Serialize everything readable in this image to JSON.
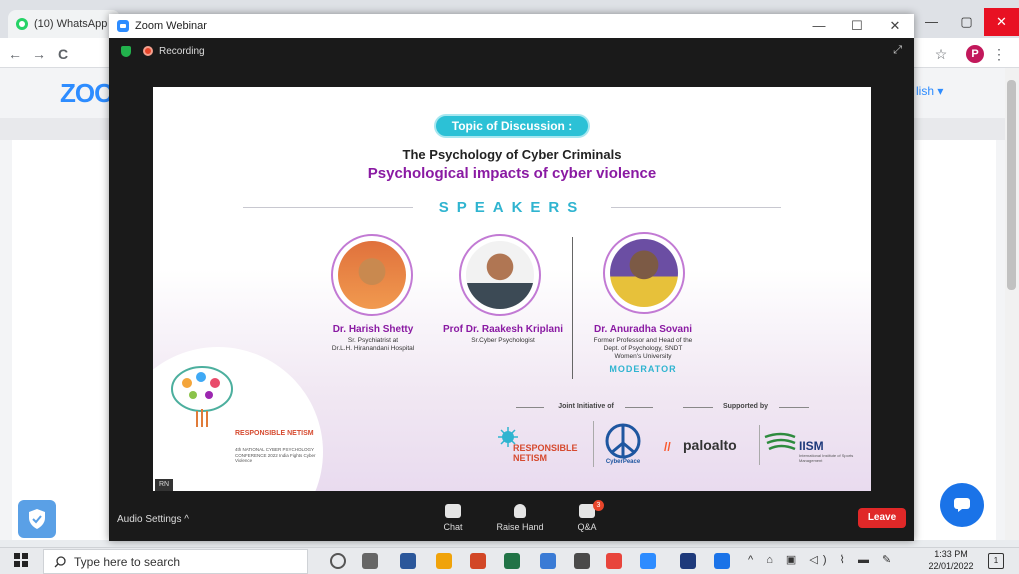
{
  "browser": {
    "tab_label": "(10) WhatsApp",
    "profile_initial": "P",
    "back_label": "←",
    "forward_label": "→",
    "reload_label": "C",
    "star_label": "☆",
    "menu_label": "⋮",
    "window_controls": [
      "—",
      "▢",
      "✕"
    ]
  },
  "page": {
    "logo_text": "ZOO",
    "language_label": "lish ▾"
  },
  "zoom": {
    "window_title": "Zoom Webinar",
    "window_controls": [
      "—",
      "☐",
      "✕"
    ],
    "recording_label": "Recording",
    "expand_label": "⤢"
  },
  "slide": {
    "topic_pill": "Topic of Discussion :",
    "title_line1": "The Psychology of Cyber Criminals",
    "title_line2": "Psychological impacts of cyber violence",
    "speakers_heading": "SPEAKERS",
    "speakers": [
      {
        "name": "Dr. Harish Shetty",
        "role": "Sr. Psychiatrist at\nDr.L.H. Hiranandani Hospital"
      },
      {
        "name": "Prof Dr. Raakesh Kriplani",
        "role": "Sr.Cyber Psychologist"
      },
      {
        "name": "Dr. Anuradha Sovani",
        "role": "Former Professor and Head of the\nDept. of Psychology, SNDT\nWomen's University"
      }
    ],
    "moderator_label": "MODERATOR",
    "joint_label": "Joint Initiative of",
    "supported_label": "Supported by",
    "conference_title": "RESPONSIBLE NETISM",
    "conference_sub": "4th NATIONAL CYBER PSYCHOLOGY CONFERENCE 2022 India Fights Cyber Violence",
    "logo_rn": "RESPONSIBLE NETISM",
    "logo_cpf": "CyberPeace",
    "logo_paloalto": "paloalto",
    "logo_paloalto_mark": "//",
    "logo_iism": "IISM",
    "logo_iism_sub": "International Institute of Sports Management",
    "rn_badge": "RN"
  },
  "toolbar": {
    "audio_settings": "Audio Settings  ^",
    "chat": "Chat",
    "raise_hand": "Raise Hand",
    "qa": "Q&A",
    "qa_badge": "3",
    "leave": "Leave"
  },
  "taskbar": {
    "search_placeholder": "Type here to search",
    "time": "1:33 PM",
    "date": "22/01/2022",
    "tray": "^ ⌂ ▣ ◁) ⌇ ▬ ✎",
    "notif": "1",
    "icon_colors": [
      "#555555",
      "#666666",
      "#2b579a",
      "#f0a30a",
      "#d24726",
      "#217346",
      "#3a7bd5",
      "#4a4a4a",
      "#e8453c",
      "#2d8cff",
      "#1e3a7b",
      "#1a73e8"
    ]
  }
}
